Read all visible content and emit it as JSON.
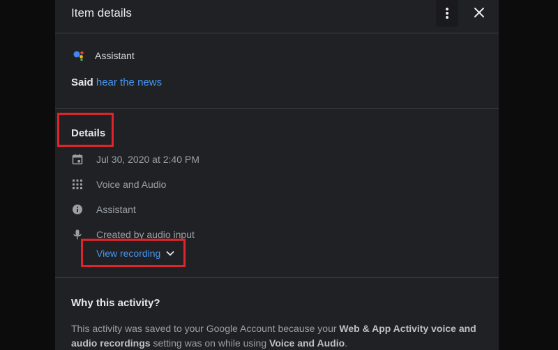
{
  "header": {
    "title": "Item details",
    "more_icon": "more-vert-icon",
    "close_icon": "close-icon"
  },
  "item": {
    "product_name": "Assistant",
    "product_icon": "google-assistant-icon",
    "said_prefix": "Said",
    "query": "hear the news"
  },
  "details": {
    "heading": "Details",
    "rows": [
      {
        "icon": "calendar-icon",
        "text": "Jul 30, 2020 at 2:40 PM"
      },
      {
        "icon": "apps-grid-icon",
        "text": "Voice and Audio"
      },
      {
        "icon": "info-icon",
        "text": "Assistant"
      },
      {
        "icon": "mic-icon",
        "text": "Created by audio input"
      }
    ],
    "view_recording_label": "View recording"
  },
  "why": {
    "heading": "Why this activity?",
    "text_before": "This activity was saved to your Google Account because your ",
    "setting_name": "Web & App Activity voice and audio recordings",
    "text_middle": " setting was on while using ",
    "product_name": "Voice and Audio",
    "text_after": "."
  },
  "colors": {
    "panel_bg": "#202124",
    "link": "#4796f0",
    "annotation": "#e0242b"
  }
}
